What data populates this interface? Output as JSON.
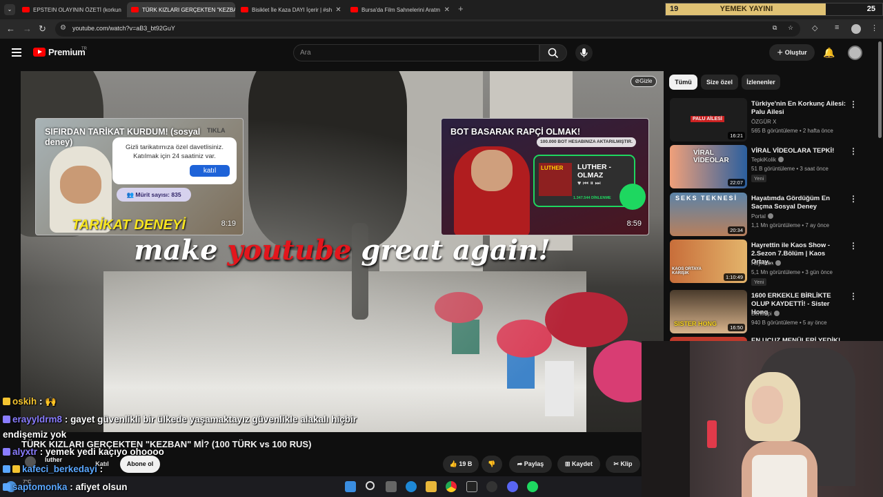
{
  "browser": {
    "tabs": [
      {
        "label": "EPSTEIN OLAYININ ÖZETİ (korkun",
        "active": false
      },
      {
        "label": "TÜRK KIZLARI GERÇEKTEN \"KEZBA",
        "active": true
      },
      {
        "label": "Bisiklet İle Kaza DAYI İçerir | #sh",
        "active": false
      },
      {
        "label": "Bursa'da Film Sahnelerini Aratm",
        "active": false
      }
    ],
    "url": "youtube.com/watch?v=aB3_bt92GuY"
  },
  "stream_overlay": {
    "left": "19",
    "label": "YEMEK YAYINI",
    "right": "25",
    "progress": 0.74
  },
  "youtube": {
    "logo_text": "Premium",
    "logo_region": "TR",
    "search_placeholder": "Ara",
    "create_label": "Oluştur"
  },
  "video": {
    "hide_label": "Gizle",
    "slogan_a": "make ",
    "slogan_b": "youtube",
    "slogan_c": " great again!",
    "endcards": [
      {
        "title": "SIFIRDAN TARİKAT KURDUM! (sosyal deney)",
        "tag": "TIKLA",
        "invite_text": "Gizli tarikatımıza özel davetlisiniz. Katılmak için 24 saatiniz var.",
        "button": "katıl",
        "members": "Mürit sayısı: 835",
        "big_text": "TARİKAT DENEYİ",
        "duration": "8:19"
      },
      {
        "title": "BOT BASARAK RAPÇİ OLMAK!",
        "note": "100.000 BOT HESABINIZA AKTARILMIŞTIR.",
        "song": "LUTHER - OLMAZ",
        "art_text": "LUTHER",
        "plays": "1.347.544 DİNLENME",
        "duration": "8:59"
      }
    ],
    "title": "TÜRK KIZLARI GERÇEKTEN \"KEZBAN\" Mİ? (100 TÜRK vs 100 RUS)",
    "channel": "luther",
    "join": "Katıl",
    "subscribe": "Abone ol",
    "likes": "19 B",
    "share": "Paylaş",
    "save": "Kaydet",
    "clip": "Klip"
  },
  "chat": [
    {
      "user": "oskih",
      "msg": "🙌",
      "color": "#f4c430"
    },
    {
      "user": "erayyldrm8",
      "msg": "gayet güvenlikli bir ülkede yaşamaktayız güvenlikle alakalı hiçbir",
      "color": "#8a7dff"
    },
    {
      "user": "",
      "msg": "endişemiz yok",
      "color": "#ffffff"
    },
    {
      "user": "alyxtr",
      "msg": "yemek yedi kaçıyo ohoooo",
      "color": "#8a7dff"
    },
    {
      "user": "kafeci_berkedayi",
      "msg": "",
      "color": "#5aa7ff"
    },
    {
      "user": "saptomonka",
      "msg": "afiyet olsun",
      "color": "#5aa7ff"
    }
  ],
  "sidebar": {
    "filters": [
      "Tümü",
      "Size özel",
      "İzlenenler"
    ],
    "recs": [
      {
        "title": "Türkiye'nin En Korkunç Ailesi: Palu Ailesi",
        "channel": "ÖZGÜR X",
        "meta": "565 B görüntüleme • 2 hafta önce",
        "duration": "16:21",
        "thumb_text": "PALU AİLESİ",
        "new": ""
      },
      {
        "title": "VİRAL VİDEOLARA TEPKİ!",
        "channel": "TepkiKolik",
        "meta": "51 B görüntüleme • 3 saat önce",
        "duration": "22:07",
        "thumb_text": "VİRAL VİDEOLAR",
        "new": "Yeni"
      },
      {
        "title": "Hayatımda Gördüğüm En Saçma Sosyal Deney",
        "channel": "Portal",
        "meta": "1,1 Mn görüntüleme • 7 ay önce",
        "duration": "20:34",
        "thumb_text": "SEKS TEKNESİ",
        "new": ""
      },
      {
        "title": "Hayrettin ile Kaos Show - 2.Sezon 7.Bölüm | Kaos Ortay...",
        "channel": "Hayrettin",
        "meta": "5,1 Mn görüntüleme • 3 gün önce",
        "duration": "1:10:49",
        "thumb_text": "KAOS ORTAYA KARIŞIK",
        "new": "Yeni"
      },
      {
        "title": "1600 ERKEKLE BİRLİKTE OLUP KAYDETTİ! - Sister Hong",
        "channel": "Bentropi",
        "meta": "940 B görüntüleme • 5 ay önce",
        "duration": "16:50",
        "thumb_text": "SISTER HONG",
        "new": ""
      },
      {
        "title": "EN UCUZ MENÜLERİ YEDİK! (7",
        "channel": "",
        "meta": "",
        "duration": "",
        "thumb_text": "",
        "new": ""
      }
    ]
  },
  "taskbar": {
    "temp": "7°C"
  }
}
